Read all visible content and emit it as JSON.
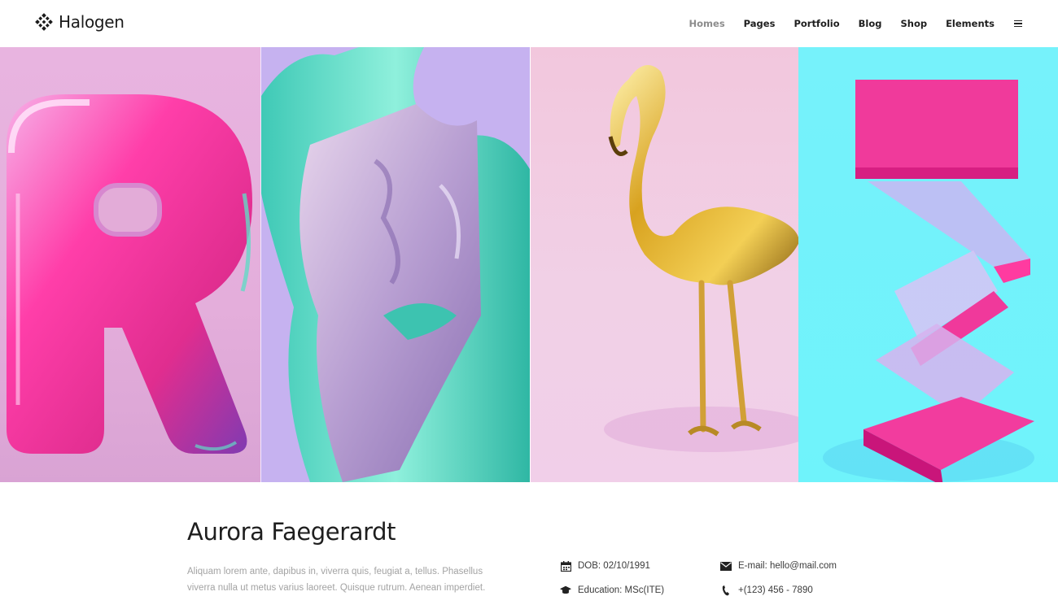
{
  "header": {
    "logo_text": "Halogen",
    "logo_icon": "halogen-logo-mark",
    "nav": [
      {
        "label": "Homes",
        "active": true
      },
      {
        "label": "Pages",
        "active": false
      },
      {
        "label": "Portfolio",
        "active": false
      },
      {
        "label": "Blog",
        "active": false
      },
      {
        "label": "Shop",
        "active": false
      },
      {
        "label": "Elements",
        "active": false
      }
    ],
    "menu_icon": "hamburger-icon"
  },
  "hero": {
    "panels": [
      {
        "subject": "pink-balloon-letter-r"
      },
      {
        "subject": "mint-chrome-figure"
      },
      {
        "subject": "gold-flamingo"
      },
      {
        "subject": "pink-glass-blocks"
      }
    ]
  },
  "profile": {
    "name": "Aurora Faegerardt",
    "bio": "Aliquam lorem ante, dapibus in, viverra quis, feugiat a, tellus. Phasellus viverra nulla ut metus varius laoreet. Quisque rutrum. Aenean imperdiet.",
    "details": {
      "dob": "DOB: 02/10/1991",
      "email": "E-mail: hello@mail.com",
      "education": "Education: MSc(ITE)",
      "phone": "+(123) 456 - 7890"
    }
  }
}
